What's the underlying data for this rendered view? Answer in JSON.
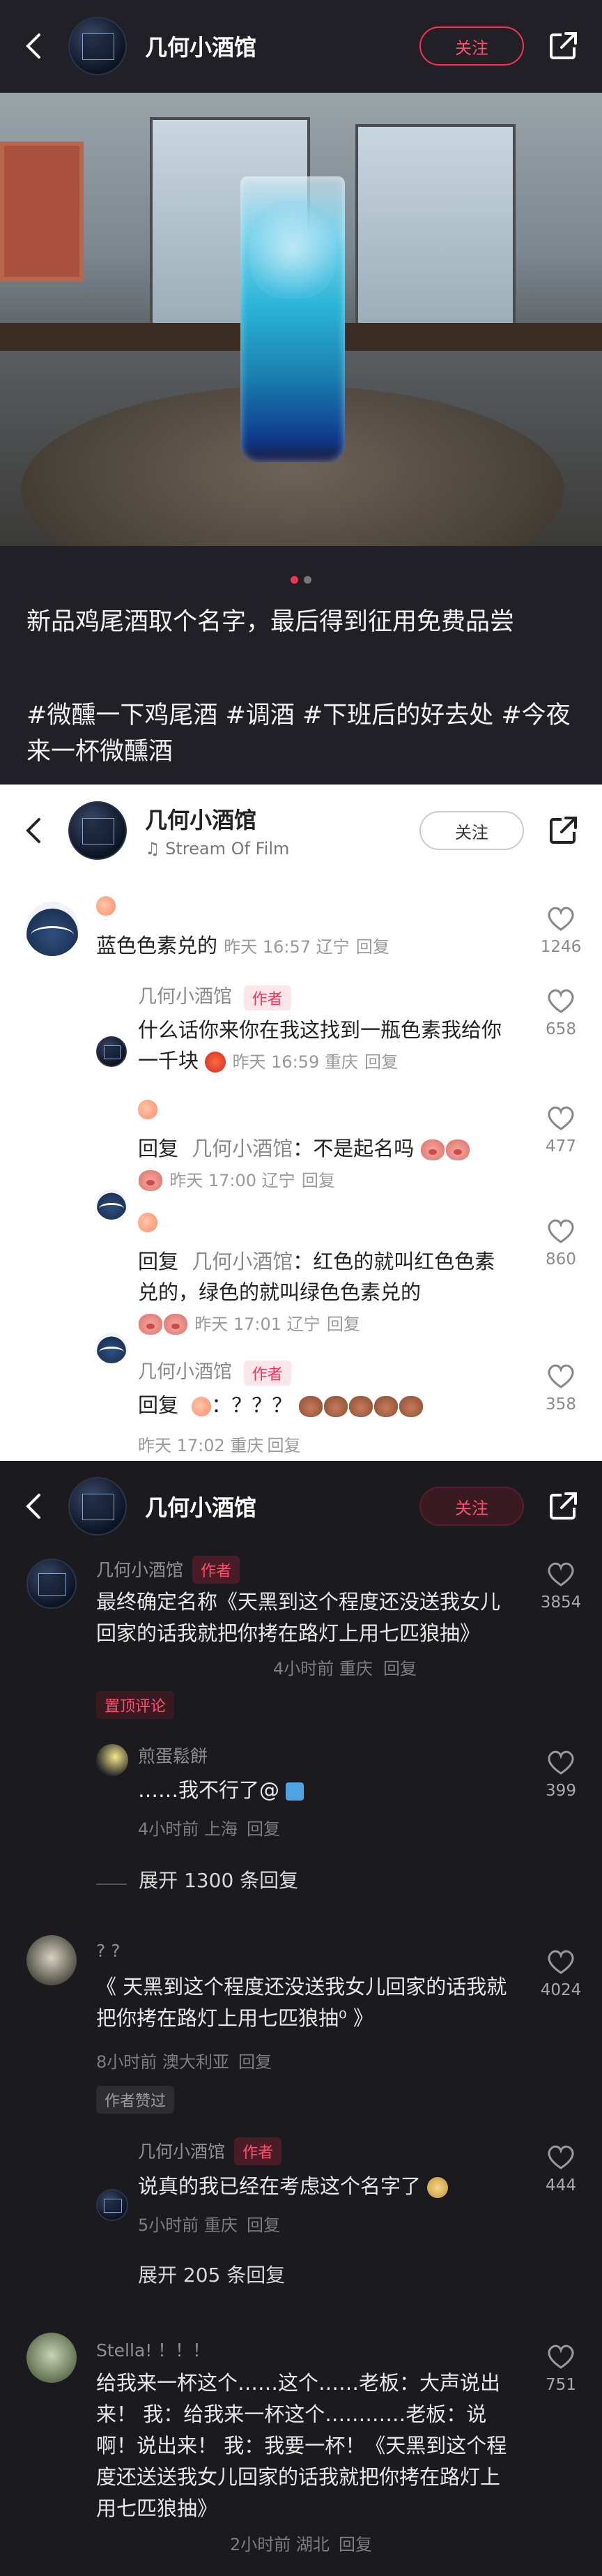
{
  "account_name": "几何小酒馆",
  "follow_label": "关注",
  "section1": {
    "post_title": "新品鸡尾酒取个名字，最后得到征用免费品尝",
    "hashtags": "#微醺一下鸡尾酒 #调酒 #下班后的好去处 #今夜来一杯微醺酒"
  },
  "section2": {
    "music": "Stream Of Film",
    "comments": [
      {
        "text": "蓝色色素兑的",
        "meta": "昨天 16:57 辽宁",
        "reply": "回复",
        "likes": "1246"
      },
      {
        "name": "几何小酒馆",
        "tag": "作者",
        "text": "什么话你来你在我这找到一瓶色素我给你一千块",
        "meta": "昨天 16:59 重庆",
        "reply": "回复",
        "likes": "658"
      },
      {
        "text_prefix": "回复",
        "text_name": "几何小酒馆",
        "text": "：不是起名吗",
        "meta": "昨天 17:00 辽宁",
        "reply": "回复",
        "likes": "477"
      },
      {
        "text_prefix": "回复",
        "text_name": "几何小酒馆",
        "text": "：红色的就叫红色色素兑的，绿色的就叫绿色色素兑的",
        "meta": "昨天 17:01 辽宁",
        "reply": "回复",
        "likes": "860"
      },
      {
        "name": "几何小酒馆",
        "tag": "作者",
        "text_prefix": "回复",
        "text": "：？？？",
        "meta": "昨天 17:02 重庆",
        "reply": "回复",
        "likes": "358"
      }
    ]
  },
  "section3": {
    "c1": {
      "name": "几何小酒馆",
      "tag": "作者",
      "text": "最终确定名称《天黑到这个程度还没送我女儿回家的话我就把你拷在路灯上用七匹狼抽》",
      "meta": "4小时前 重庆",
      "reply": "回复",
      "pin": "置顶评论",
      "likes": "3854"
    },
    "c1r": {
      "name": "煎蛋鬆餅",
      "text": "……我不行了@",
      "meta": "4小时前 上海",
      "reply": "回复",
      "likes": "399"
    },
    "c1_expand": "展开 1300 条回复",
    "c2": {
      "name": "? ?",
      "text": "《 天黑到这个程度还没送我女儿回家的话我就把你拷在路灯上用七匹狼抽⁰ 》",
      "meta": "8小时前 澳大利亚",
      "reply": "回复",
      "badge": "作者赞过",
      "likes": "4024"
    },
    "c2r": {
      "name": "几何小酒馆",
      "tag": "作者",
      "text": "说真的我已经在考虑这个名字了",
      "meta": "5小时前 重庆",
      "reply": "回复",
      "likes": "444"
    },
    "c2_expand": "展开 205 条回复",
    "c3": {
      "name": "Stella! ！！！",
      "text": "给我来一杯这个……这个……老板：大声说出来！ 我：给我来一杯这个…………老板：说啊！说出来！ 我：我要一杯！《天黑到这个程度还送送我女儿回家的话我就把你拷在路灯上用七匹狼抽》",
      "meta": "2小时前 湖北",
      "reply": "回复",
      "likes": "751"
    }
  },
  "colors": {
    "accent": "#ff2f5a",
    "author_tag_bg_light": "#fde6ea",
    "author_tag_text": "#ff2f5a"
  },
  "icons": [
    "back-arrow-icon",
    "share-icon",
    "heart-icon",
    "music-note-icon",
    "peach-icon",
    "pig-emoji-icon"
  ]
}
